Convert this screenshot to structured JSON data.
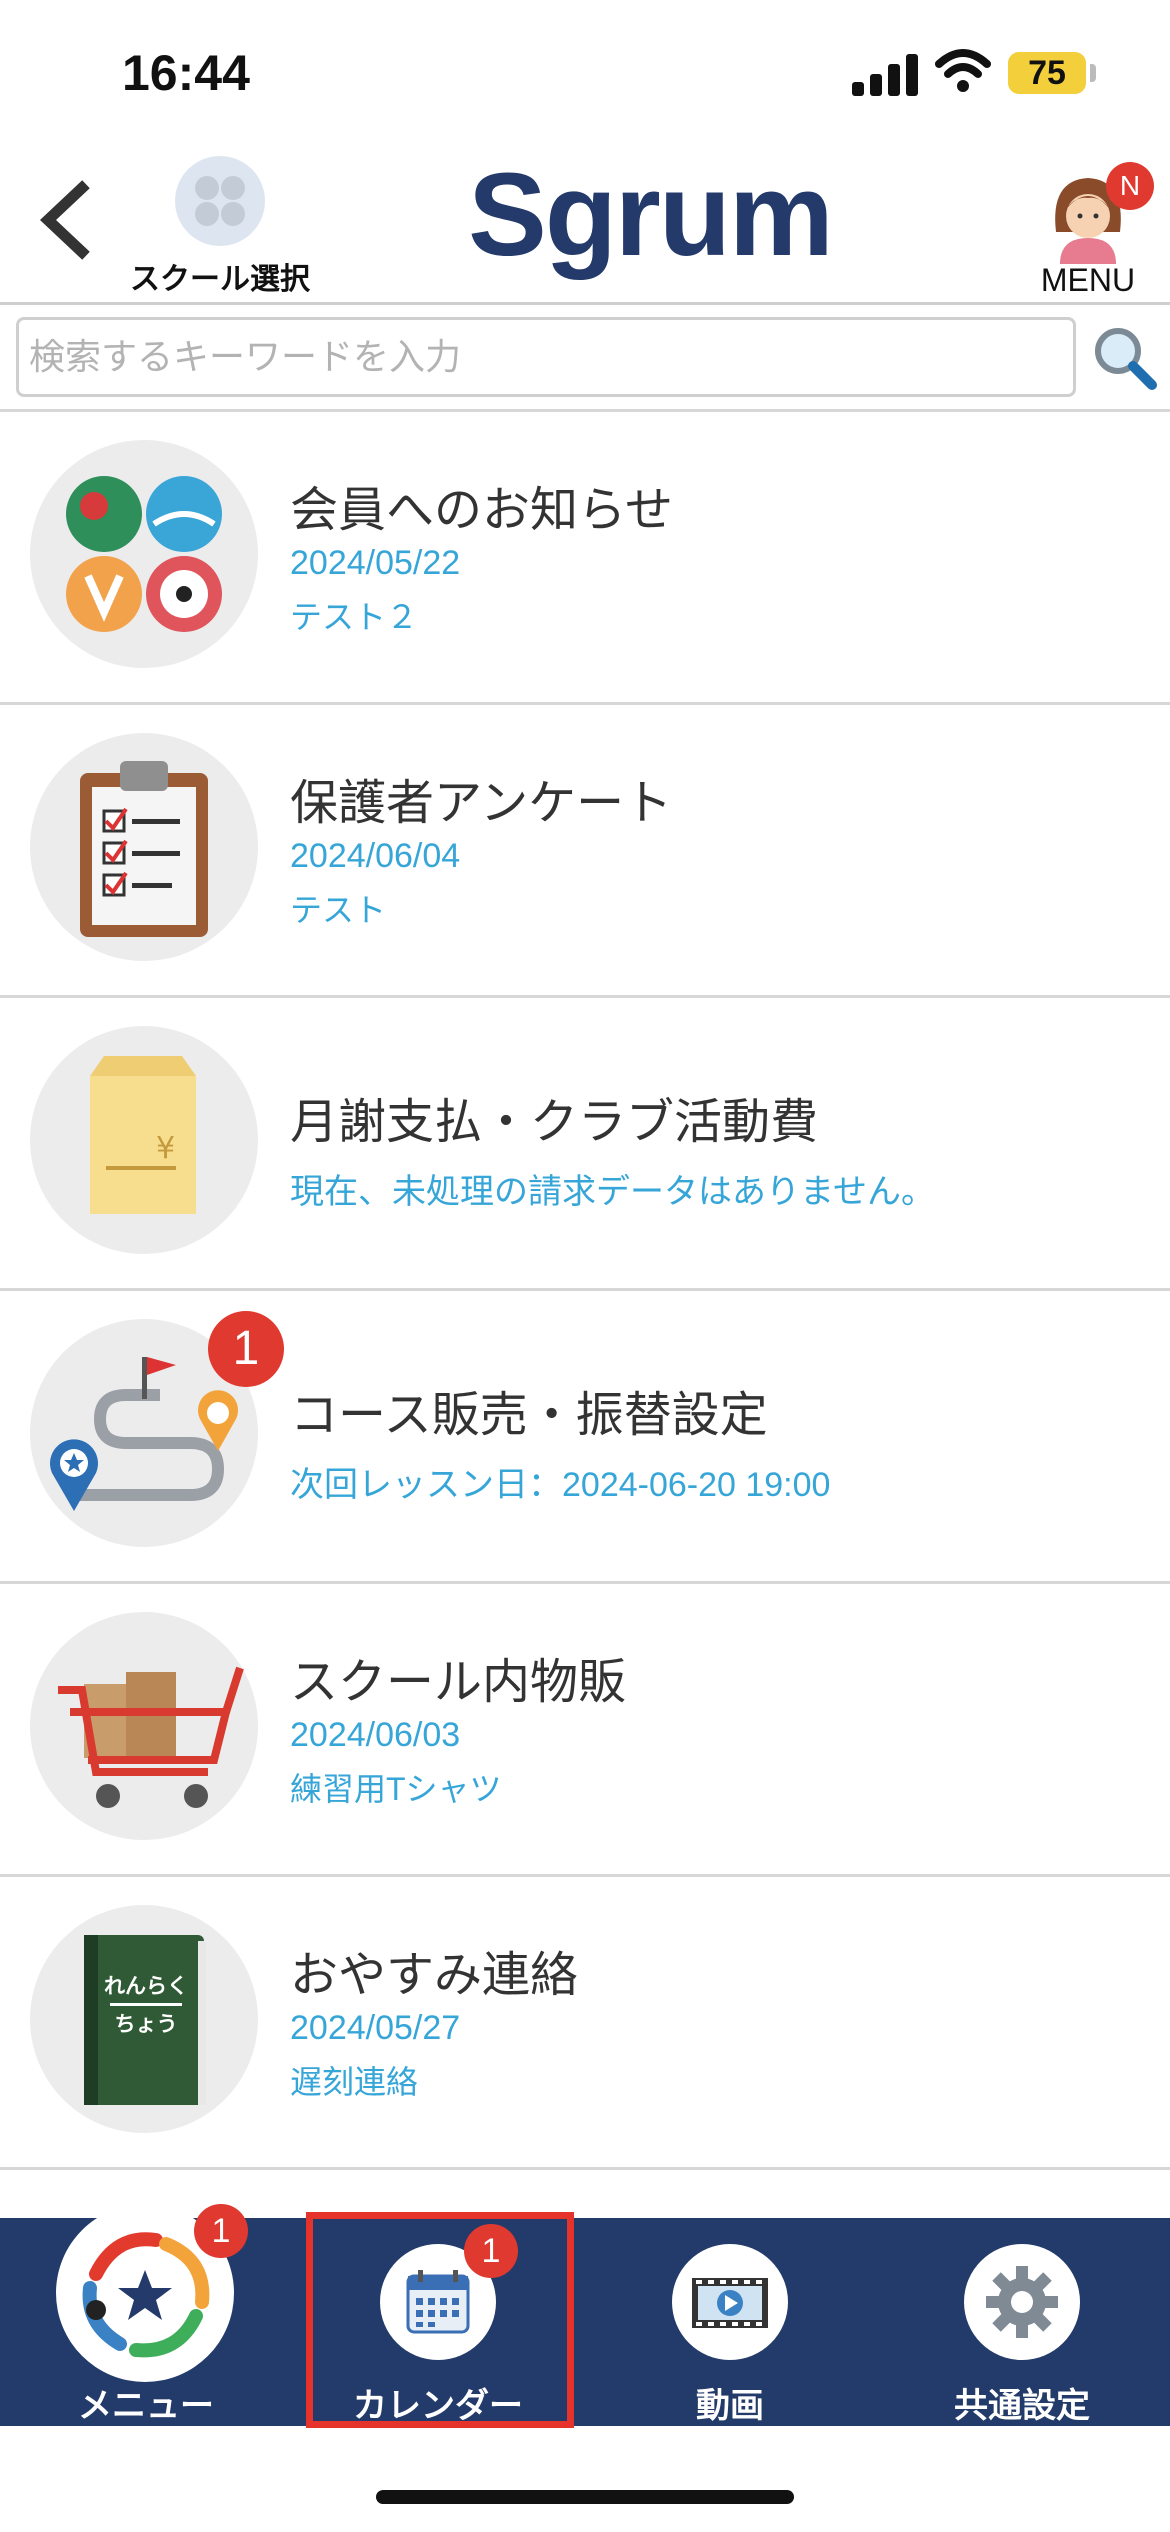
{
  "status_bar": {
    "time": "16:44",
    "battery": "75"
  },
  "header": {
    "school_select_label": "スクール選択",
    "app_logo": "Sgrum",
    "menu_label": "MENU",
    "menu_badge": "N"
  },
  "search": {
    "placeholder": "検索するキーワードを入力"
  },
  "list_items": [
    {
      "title": "会員へのお知らせ",
      "date": "2024/05/22",
      "detail": "テスト２"
    },
    {
      "title": "保護者アンケート",
      "date": "2024/06/04",
      "detail": "テスト"
    },
    {
      "title": "月謝支払・クラブ活動費",
      "message": "現在、未処理の請求データはありません。"
    },
    {
      "title": "コース販売・振替設定",
      "message": "次回レッスン日：2024-06-20 19:00",
      "badge": "1"
    },
    {
      "title": "スクール内物販",
      "date": "2024/06/03",
      "detail": "練習用Tシャツ"
    },
    {
      "title": "おやすみ連絡",
      "date": "2024/05/27",
      "detail": "遅刻連絡",
      "notebook_text": [
        "れんらく",
        "ちょう"
      ]
    }
  ],
  "tab_bar": {
    "tabs": [
      {
        "label": "メニュー",
        "badge": "1"
      },
      {
        "label": "カレンダー",
        "badge": "1"
      },
      {
        "label": "動画"
      },
      {
        "label": "共通設定"
      }
    ]
  },
  "colors": {
    "accent_blue": "#36a5d8",
    "navy": "#233b6a",
    "badge_red": "#e03a30",
    "highlight_red": "#e5322b"
  }
}
